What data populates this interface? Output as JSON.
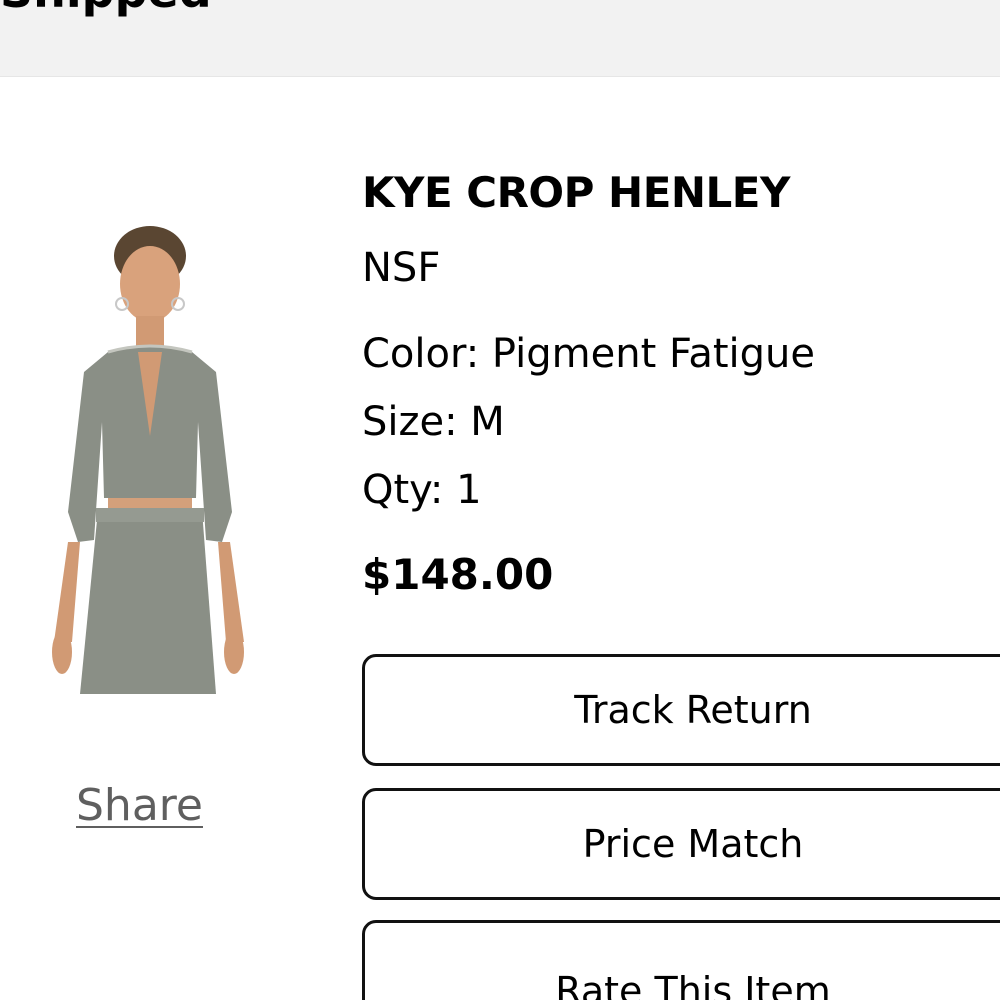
{
  "banner": {
    "title": "Shipped"
  },
  "product": {
    "title": "KYE CROP HENLEY",
    "brand": "NSF",
    "color": "Color: Pigment Fatigue",
    "size": "Size: M",
    "qty": "Qty: 1",
    "price": "$148.00",
    "image_icon": "product-photo"
  },
  "share": {
    "label": "Share"
  },
  "actions": {
    "track_return": "Track Return",
    "price_match": "Price Match",
    "rate_item": "Rate This Item"
  },
  "colors": {
    "banner_bg": "#f2f2f2",
    "garment": "#8a8f86",
    "share_text": "#5f5f5f",
    "button_border": "#111111"
  }
}
